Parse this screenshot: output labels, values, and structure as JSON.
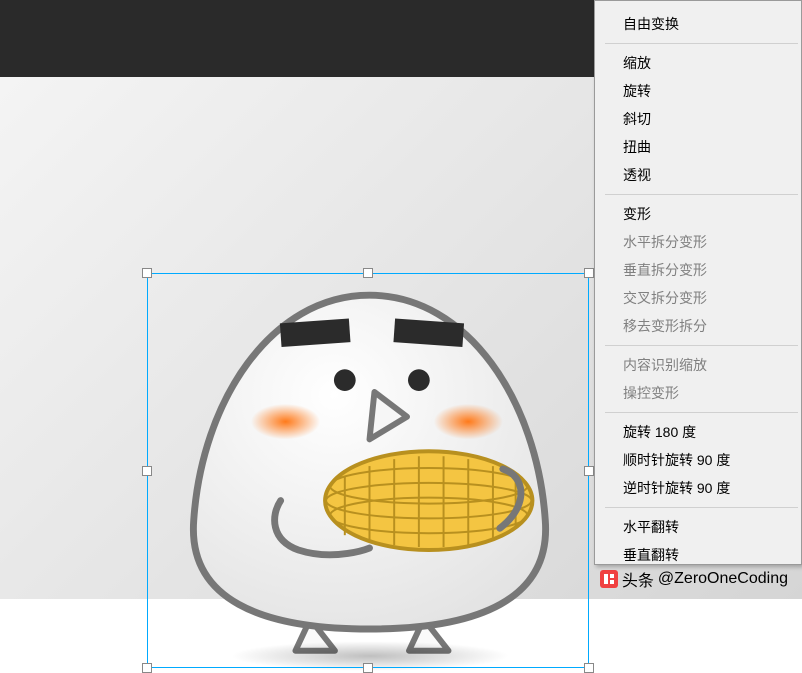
{
  "menu": {
    "groups": [
      [
        {
          "id": "free-transform",
          "label": "自由变换",
          "enabled": true
        }
      ],
      [
        {
          "id": "scale",
          "label": "缩放",
          "enabled": true
        },
        {
          "id": "rotate",
          "label": "旋转",
          "enabled": true
        },
        {
          "id": "skew",
          "label": "斜切",
          "enabled": true
        },
        {
          "id": "distort",
          "label": "扭曲",
          "enabled": true
        },
        {
          "id": "perspective",
          "label": "透视",
          "enabled": true
        }
      ],
      [
        {
          "id": "warp",
          "label": "变形",
          "enabled": true
        },
        {
          "id": "split-warp-h",
          "label": "水平拆分变形",
          "enabled": false
        },
        {
          "id": "split-warp-v",
          "label": "垂直拆分变形",
          "enabled": false
        },
        {
          "id": "split-warp-cross",
          "label": "交叉拆分变形",
          "enabled": false
        },
        {
          "id": "remove-warp-split",
          "label": "移去变形拆分",
          "enabled": false
        }
      ],
      [
        {
          "id": "content-aware-scale",
          "label": "内容识别缩放",
          "enabled": false
        },
        {
          "id": "puppet-warp",
          "label": "操控变形",
          "enabled": false
        }
      ],
      [
        {
          "id": "rotate-180",
          "label": "旋转 180 度",
          "enabled": true
        },
        {
          "id": "rotate-90-cw",
          "label": "顺时针旋转 90 度",
          "enabled": true
        },
        {
          "id": "rotate-90-ccw",
          "label": "逆时针旋转 90 度",
          "enabled": true
        }
      ],
      [
        {
          "id": "flip-horizontal",
          "label": "水平翻转",
          "enabled": true
        },
        {
          "id": "flip-vertical",
          "label": "垂直翻转",
          "enabled": true
        }
      ]
    ]
  },
  "watermark": {
    "prefix": "头条",
    "handle": "@ZeroOneCoding"
  },
  "colors": {
    "selection": "#00aaff",
    "topbar": "#2a2a2a"
  }
}
